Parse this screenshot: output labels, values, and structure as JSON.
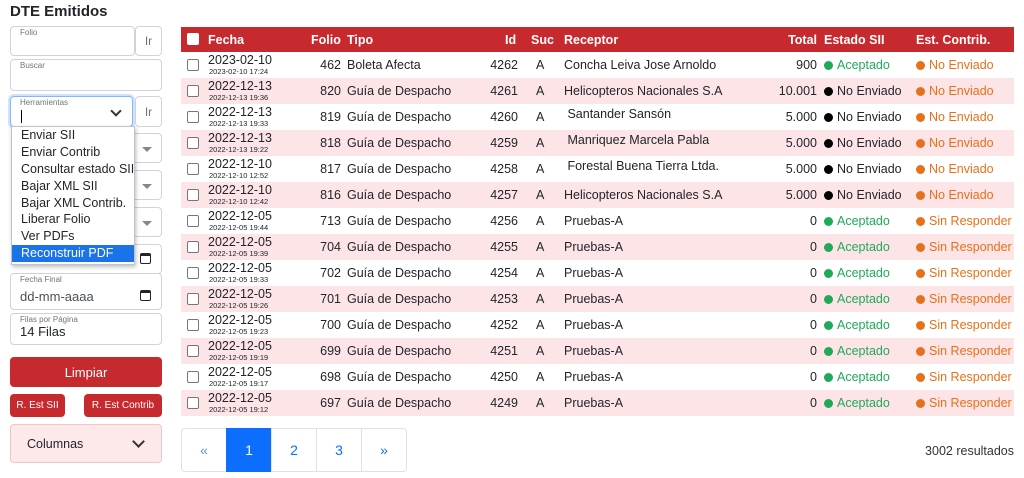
{
  "page_title": "DTE Emitidos",
  "filters": {
    "folio_label": "Folio",
    "folio_btn": "Ir",
    "buscar_label": "Buscar",
    "herramientas_label": "Herramientas",
    "herramientas_btn": "Ir",
    "fecha_final_label": "Fecha Final",
    "fecha_final_placeholder": "dd-mm-aaaa",
    "filas_label": "Filas por Página",
    "filas_value": "14 Filas"
  },
  "tools_menu": [
    "Enviar SII",
    "Enviar Contrib",
    "Consultar estado SII",
    "Bajar XML SII",
    "Bajar XML Contrib.",
    "Liberar Folio",
    "Ver PDFs",
    "Reconstruir PDF"
  ],
  "buttons": {
    "limpiar": "Limpiar",
    "r_est_sii": "R. Est SII",
    "r_est_contrib": "R. Est Contrib",
    "columnas": "Columnas"
  },
  "table": {
    "headers": {
      "fecha": "Fecha",
      "folio": "Folio",
      "tipo": "Tipo",
      "id": "Id",
      "suc": "Suc",
      "receptor": "Receptor",
      "total": "Total",
      "estado_sii": "Estado SII",
      "est_contrib": "Est. Contrib."
    },
    "rows": [
      {
        "fecha": "2023-02-10",
        "fecha_full": "2023-02-10 17:24",
        "folio": "462",
        "tipo": "Boleta Afecta",
        "id": "4262",
        "suc": "A",
        "receptor": "Concha Leiva Jose Arnoldo",
        "total": "900",
        "estado_sii": "Aceptado",
        "est_contrib": "No Enviado"
      },
      {
        "fecha": "2022-12-13",
        "fecha_full": "2022-12-13 19:36",
        "folio": "820",
        "tipo": "Guía de Despacho",
        "id": "4261",
        "suc": "A",
        "receptor": "Helicopteros Nacionales S.A",
        "total": "10.001",
        "estado_sii": "No Enviado",
        "est_contrib": "No Enviado"
      },
      {
        "fecha": "2022-12-13",
        "fecha_full": "2022-12-13 19:33",
        "folio": "819",
        "tipo": "Guía de Despacho",
        "id": "4260",
        "suc": "A",
        "receptor": " Santander Sansón",
        "total": "5.000",
        "estado_sii": "No Enviado",
        "est_contrib": "No Enviado"
      },
      {
        "fecha": "2022-12-13",
        "fecha_full": "2022-12-13 19:22",
        "folio": "818",
        "tipo": "Guía de Despacho",
        "id": "4259",
        "suc": "A",
        "receptor": " Manriquez Marcela Pabla",
        "total": "5.000",
        "estado_sii": "No Enviado",
        "est_contrib": "No Enviado"
      },
      {
        "fecha": "2022-12-10",
        "fecha_full": "2022-12-10 12:52",
        "folio": "817",
        "tipo": "Guía de Despacho",
        "id": "4258",
        "suc": "A",
        "receptor": " Forestal Buena Tierra Ltda.",
        "total": "5.000",
        "estado_sii": "No Enviado",
        "est_contrib": "No Enviado"
      },
      {
        "fecha": "2022-12-10",
        "fecha_full": "2022-12-10 12:42",
        "folio": "816",
        "tipo": "Guía de Despacho",
        "id": "4257",
        "suc": "A",
        "receptor": "Helicopteros Nacionales S.A",
        "total": "5.000",
        "estado_sii": "No Enviado",
        "est_contrib": "No Enviado"
      },
      {
        "fecha": "2022-12-05",
        "fecha_full": "2022-12-05 19:44",
        "folio": "713",
        "tipo": "Guía de Despacho",
        "id": "4256",
        "suc": "A",
        "receptor": "Pruebas-A",
        "total": "0",
        "estado_sii": "Aceptado",
        "est_contrib": "Sin Responder"
      },
      {
        "fecha": "2022-12-05",
        "fecha_full": "2022-12-05 19:39",
        "folio": "704",
        "tipo": "Guía de Despacho",
        "id": "4255",
        "suc": "A",
        "receptor": "Pruebas-A",
        "total": "0",
        "estado_sii": "Aceptado",
        "est_contrib": "Sin Responder"
      },
      {
        "fecha": "2022-12-05",
        "fecha_full": "2022-12-05 19:33",
        "folio": "702",
        "tipo": "Guía de Despacho",
        "id": "4254",
        "suc": "A",
        "receptor": "Pruebas-A",
        "total": "0",
        "estado_sii": "Aceptado",
        "est_contrib": "Sin Responder"
      },
      {
        "fecha": "2022-12-05",
        "fecha_full": "2022-12-05 19:26",
        "folio": "701",
        "tipo": "Guía de Despacho",
        "id": "4253",
        "suc": "A",
        "receptor": "Pruebas-A",
        "total": "0",
        "estado_sii": "Aceptado",
        "est_contrib": "Sin Responder"
      },
      {
        "fecha": "2022-12-05",
        "fecha_full": "2022-12-05 19:23",
        "folio": "700",
        "tipo": "Guía de Despacho",
        "id": "4252",
        "suc": "A",
        "receptor": "Pruebas-A",
        "total": "0",
        "estado_sii": "Aceptado",
        "est_contrib": "Sin Responder"
      },
      {
        "fecha": "2022-12-05",
        "fecha_full": "2022-12-05 19:19",
        "folio": "699",
        "tipo": "Guía de Despacho",
        "id": "4251",
        "suc": "A",
        "receptor": "Pruebas-A",
        "total": "0",
        "estado_sii": "Aceptado",
        "est_contrib": "Sin Responder"
      },
      {
        "fecha": "2022-12-05",
        "fecha_full": "2022-12-05 19:17",
        "folio": "698",
        "tipo": "Guía de Despacho",
        "id": "4250",
        "suc": "A",
        "receptor": "Pruebas-A",
        "total": "0",
        "estado_sii": "Aceptado",
        "est_contrib": "Sin Responder"
      },
      {
        "fecha": "2022-12-05",
        "fecha_full": "2022-12-05 19:12",
        "folio": "697",
        "tipo": "Guía de Despacho",
        "id": "4249",
        "suc": "A",
        "receptor": "Pruebas-A",
        "total": "0",
        "estado_sii": "Aceptado",
        "est_contrib": "Sin Responder"
      }
    ]
  },
  "status_colors": {
    "Aceptado": "#1faa59",
    "No Enviado": "#000000",
    "contrib": "#e8701a"
  },
  "pagination": {
    "prev": "«",
    "pages": [
      "1",
      "2",
      "3"
    ],
    "active": "1",
    "next": "»",
    "results": "3002 resultados"
  }
}
